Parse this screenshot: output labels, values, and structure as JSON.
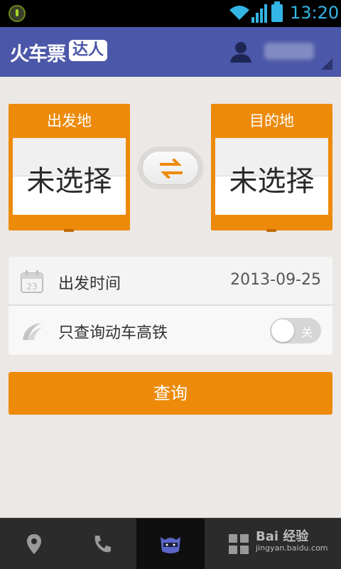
{
  "status_bar": {
    "time": "13:20"
  },
  "app_bar": {
    "logo_text": "火车票",
    "logo_badge": "达人"
  },
  "from_station": {
    "title": "出发地",
    "value": "未选择"
  },
  "to_station": {
    "title": "目的地",
    "value": "未选择"
  },
  "options": {
    "date_label": "出发时间",
    "date_value": "2013-09-25",
    "calendar_day": "23",
    "highspeed_label": "只查询动车高铁",
    "toggle_state": "关"
  },
  "query_button_label": "查询",
  "bottom_nav": [
    {
      "icon": "location-pin-icon"
    },
    {
      "icon": "phone-icon"
    },
    {
      "icon": "ninja-mascot-icon",
      "active": true
    },
    {
      "icon": "grid-apps-icon"
    }
  ],
  "watermark": {
    "brand": "Bai 经验",
    "url": "jingyan.baidu.com"
  },
  "colors": {
    "accent": "#ed8a0a",
    "appbar": "#4b57a8",
    "status_time": "#33b5e5"
  }
}
